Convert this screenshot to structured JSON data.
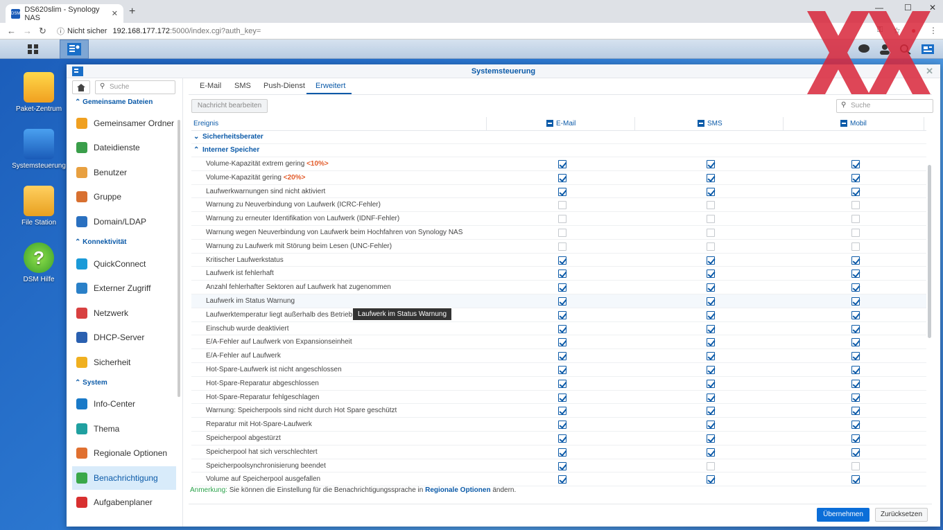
{
  "browser": {
    "tab_title": "DS620slim - Synology NAS",
    "favicon_text": "DSM",
    "new_tab": "+",
    "security": "Nicht sicher",
    "url_host": "192.168.177.172",
    "url_path": ":5000/index.cgi?auth_key="
  },
  "desktop": {
    "icons": [
      {
        "label": "Paket-Zentrum"
      },
      {
        "label": "Systemsteuerung"
      },
      {
        "label": "File Station"
      },
      {
        "label": "DSM Hilfe"
      }
    ]
  },
  "window": {
    "title": "Systemsteuerung"
  },
  "sidebar": {
    "search_placeholder": "Suche",
    "sections": [
      {
        "title": "Gemeinsame Dateien"
      },
      {
        "title": "Konnektivität"
      },
      {
        "title": "System"
      }
    ],
    "items": [
      {
        "label": "Gemeinsamer Ordner",
        "color": "#f0a020"
      },
      {
        "label": "Dateidienste",
        "color": "#3a9e4a"
      },
      {
        "label": "Benutzer",
        "color": "#e8a040"
      },
      {
        "label": "Gruppe",
        "color": "#d87030"
      },
      {
        "label": "Domain/LDAP",
        "color": "#2a70c0"
      },
      {
        "label": "QuickConnect",
        "color": "#1a9ad8"
      },
      {
        "label": "Externer Zugriff",
        "color": "#2a80c8"
      },
      {
        "label": "Netzwerk",
        "color": "#d84040"
      },
      {
        "label": "DHCP-Server",
        "color": "#2a60b0"
      },
      {
        "label": "Sicherheit",
        "color": "#f0b020"
      },
      {
        "label": "Info-Center",
        "color": "#1a7ac8"
      },
      {
        "label": "Thema",
        "color": "#20a0a0"
      },
      {
        "label": "Regionale Optionen",
        "color": "#e07030"
      },
      {
        "label": "Benachrichtigung",
        "color": "#3aa84a"
      },
      {
        "label": "Aufgabenplaner",
        "color": "#d83030"
      }
    ]
  },
  "tabs": [
    "E-Mail",
    "SMS",
    "Push-Dienst",
    "Erweitert"
  ],
  "toolbar": {
    "edit_label": "Nachricht bearbeiten",
    "search_placeholder": "Suche"
  },
  "grid": {
    "headers": [
      "Ereignis",
      "E-Mail",
      "SMS",
      "Mobil"
    ],
    "groups": [
      "Sicherheitsberater",
      "Interner Speicher"
    ],
    "rows": [
      {
        "label": "Volume-Kapazität extrem gering ",
        "pct": "<10%>",
        "email": true,
        "sms": true,
        "mobil": true
      },
      {
        "label": "Volume-Kapazität gering ",
        "pct": "<20%>",
        "email": true,
        "sms": true,
        "mobil": true
      },
      {
        "label": "Laufwerkwarnungen sind nicht aktiviert",
        "pct": "",
        "email": true,
        "sms": true,
        "mobil": true
      },
      {
        "label": "Warnung zu Neuverbindung von Laufwerk (ICRC-Fehler)",
        "pct": "",
        "email": false,
        "sms": false,
        "mobil": false
      },
      {
        "label": "Warnung zu erneuter Identifikation von Laufwerk (IDNF-Fehler)",
        "pct": "",
        "email": false,
        "sms": false,
        "mobil": false
      },
      {
        "label": "Warnung wegen Neuverbindung von Laufwerk beim Hochfahren von Synology NAS",
        "pct": "",
        "email": false,
        "sms": false,
        "mobil": false
      },
      {
        "label": "Warnung zu Laufwerk mit Störung beim Lesen (UNC-Fehler)",
        "pct": "",
        "email": false,
        "sms": false,
        "mobil": false
      },
      {
        "label": "Kritischer Laufwerkstatus",
        "pct": "",
        "email": true,
        "sms": true,
        "mobil": true
      },
      {
        "label": "Laufwerk ist fehlerhaft",
        "pct": "",
        "email": true,
        "sms": true,
        "mobil": true
      },
      {
        "label": "Anzahl fehlerhafter Sektoren auf Laufwerk hat zugenommen",
        "pct": "",
        "email": true,
        "sms": true,
        "mobil": true
      },
      {
        "label": "Laufwerk im Status Warnung",
        "pct": "",
        "email": true,
        "sms": true,
        "mobil": true
      },
      {
        "label": "Laufwerktemperatur liegt außerhalb des Betriebste",
        "pct": "",
        "email": true,
        "sms": true,
        "mobil": true
      },
      {
        "label": "Einschub wurde deaktiviert",
        "pct": "",
        "email": true,
        "sms": true,
        "mobil": true
      },
      {
        "label": "E/A-Fehler auf Laufwerk von Expansionseinheit",
        "pct": "",
        "email": true,
        "sms": true,
        "mobil": true
      },
      {
        "label": "E/A-Fehler auf Laufwerk",
        "pct": "",
        "email": true,
        "sms": true,
        "mobil": true
      },
      {
        "label": "Hot-Spare-Laufwerk ist nicht angeschlossen",
        "pct": "",
        "email": true,
        "sms": true,
        "mobil": true
      },
      {
        "label": "Hot-Spare-Reparatur abgeschlossen",
        "pct": "",
        "email": true,
        "sms": true,
        "mobil": true
      },
      {
        "label": "Hot-Spare-Reparatur fehlgeschlagen",
        "pct": "",
        "email": true,
        "sms": true,
        "mobil": true
      },
      {
        "label": "Warnung: Speicherpools sind nicht durch Hot Spare geschützt",
        "pct": "",
        "email": true,
        "sms": true,
        "mobil": true
      },
      {
        "label": "Reparatur mit Hot-Spare-Laufwerk",
        "pct": "",
        "email": true,
        "sms": true,
        "mobil": true
      },
      {
        "label": "Speicherpool abgestürzt",
        "pct": "",
        "email": true,
        "sms": true,
        "mobil": true
      },
      {
        "label": "Speicherpool hat sich verschlechtert",
        "pct": "",
        "email": true,
        "sms": true,
        "mobil": true
      },
      {
        "label": "Speicherpoolsynchronisierung beendet",
        "pct": "",
        "email": true,
        "sms": false,
        "mobil": false
      },
      {
        "label": "Volume auf Speicherpool ausgefallen",
        "pct": "",
        "email": true,
        "sms": true,
        "mobil": true
      }
    ]
  },
  "tooltip": "Laufwerk im Status Warnung",
  "note": {
    "prefix": "Anmerkung:",
    "text": " Sie können die Einstellung für die Benachrichtigungssprache in ",
    "link": "Regionale Optionen",
    "suffix": " ändern."
  },
  "buttons": {
    "apply": "Übernehmen",
    "reset": "Zurücksetzen"
  }
}
